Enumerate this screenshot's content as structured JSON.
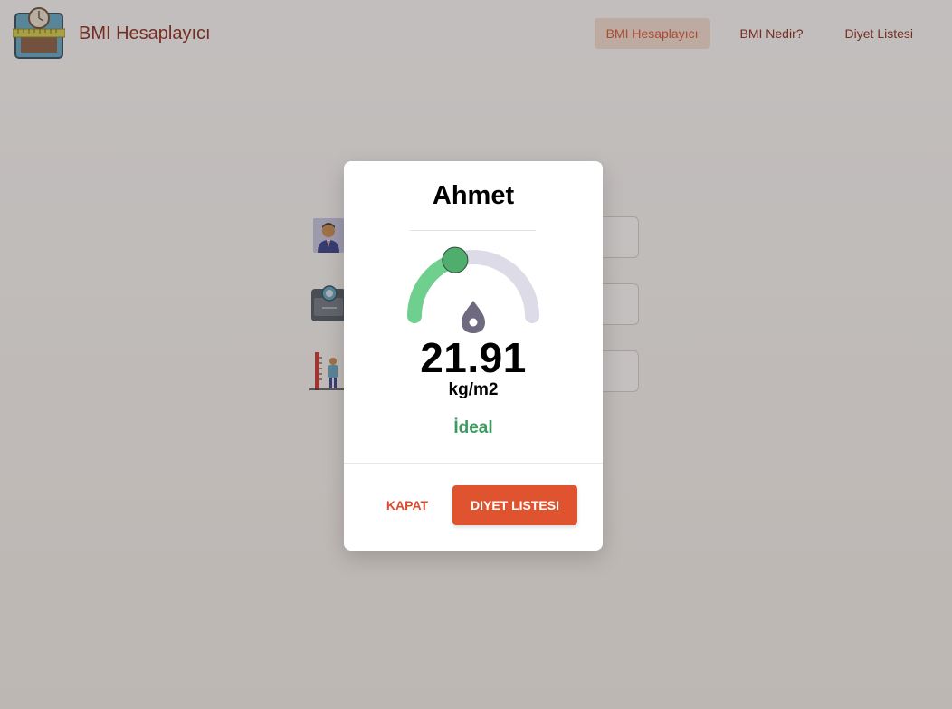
{
  "app": {
    "title": "BMI Hesaplayıcı"
  },
  "nav": {
    "items": [
      {
        "label": "BMI Hesaplayıcı",
        "active": true
      },
      {
        "label": "BMI Nedir?",
        "active": false
      },
      {
        "label": "Diyet Listesi",
        "active": false
      }
    ]
  },
  "form": {
    "name_icon": "person-icon",
    "weight_icon": "scale-icon",
    "height_icon": "height-measure-icon"
  },
  "modal": {
    "title": "Ahmet",
    "bmi_value": "21.91",
    "unit": "kg/m2",
    "status": "İdeal",
    "gauge_level": 0.4,
    "close_label": "KAPAT",
    "diet_label": "DIYET LISTESI"
  },
  "colors": {
    "brand": "#8b2515",
    "accent": "#e0532f",
    "status_ideal": "#3c9a5f",
    "gauge_track": "#dddbe8",
    "gauge_fill": "#6fd08e",
    "needle": "#6f6a80"
  }
}
